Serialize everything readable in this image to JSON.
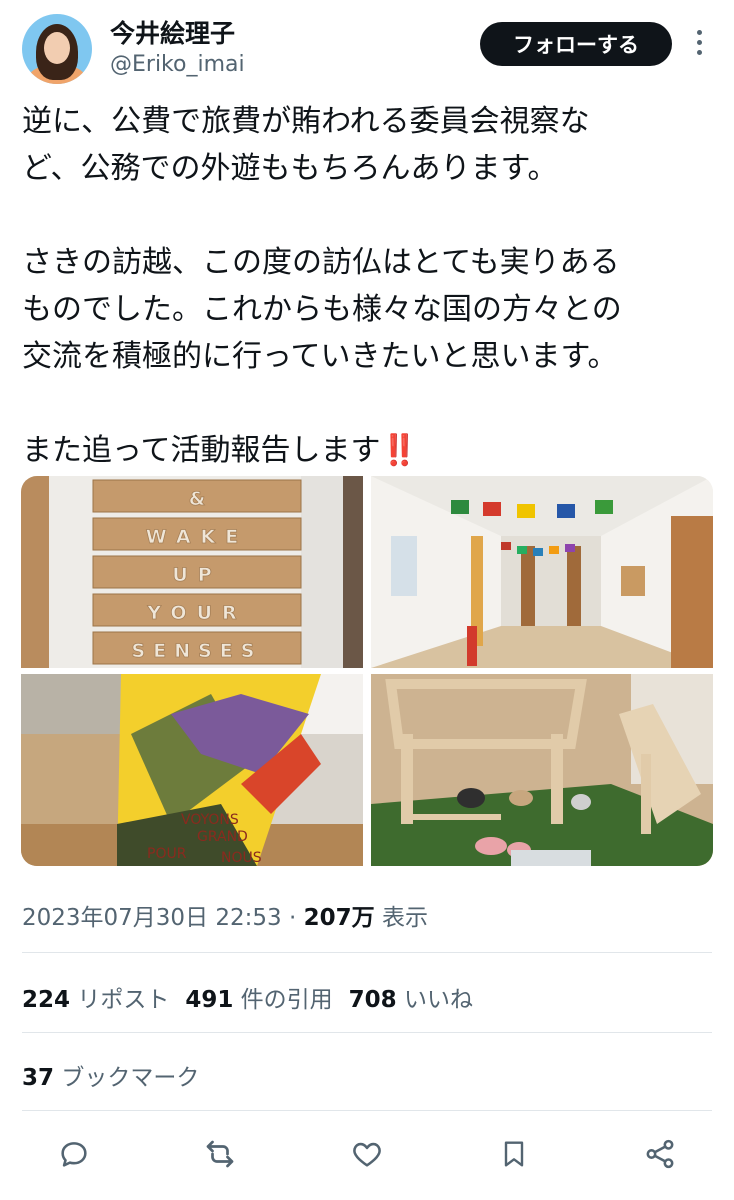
{
  "author": {
    "display_name": "今井絵理子",
    "handle": "@Eriko_imai",
    "follow_label": "フォローする"
  },
  "tweet": {
    "lines": [
      "逆に、公費で旅費が賄われる委員会視察な",
      "ど、公務での外遊ももちろんあります。",
      "",
      "さきの訪越、この度の訪仏はとても実りある",
      "ものでした。これからも様々な国の方々との",
      "交流を積極的に行っていきたいと思います。",
      "",
      "また追って活動報告します"
    ],
    "emoji": "‼️",
    "photos": [
      {
        "letters": [
          "&",
          "WAKE",
          "UP",
          "YOUR",
          "SENSES"
        ]
      },
      {
        "name": "hallway-flags"
      },
      {
        "poster_text": [
          "VOYONS",
          "GRAND",
          "POUR",
          "NOUS"
        ]
      },
      {
        "name": "toy-farm"
      }
    ]
  },
  "meta": {
    "datetime": "2023年07月30日 22:53",
    "separator": " · ",
    "views_count": "207万",
    "views_label": "表示"
  },
  "stats": {
    "reposts_count": "224",
    "reposts_label": "リポスト",
    "quotes_count": "491",
    "quotes_label": "件の引用",
    "likes_count": "708",
    "likes_label": "いいね",
    "bookmarks_count": "37",
    "bookmarks_label": "ブックマーク"
  },
  "actions": [
    "reply-icon",
    "repost-icon",
    "like-icon",
    "bookmark-icon",
    "share-icon"
  ],
  "colors": {
    "text": "#0f1419",
    "secondary": "#536471",
    "follow_bg": "#0f1419",
    "emoji_red": "#e0245e"
  }
}
